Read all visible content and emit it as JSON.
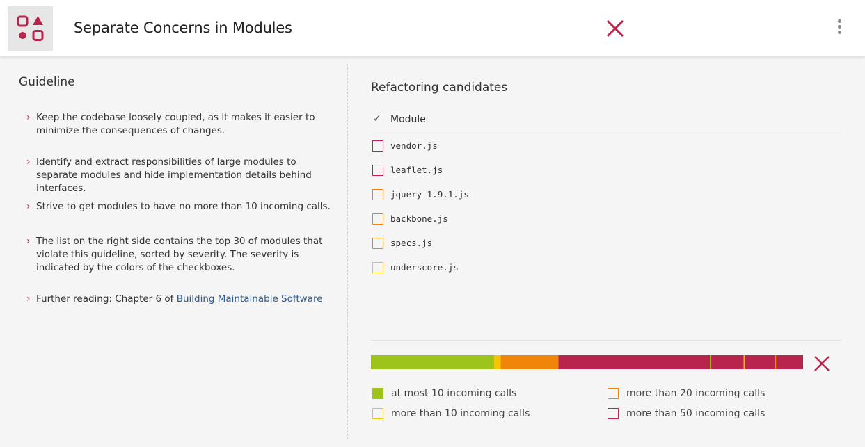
{
  "header": {
    "title": "Separate Concerns in Modules",
    "logo_icon": "modules-grid-icon",
    "status_icon": "fail-x-icon",
    "menu_icon": "kebab-menu-icon"
  },
  "guideline": {
    "heading": "Guideline",
    "items": [
      "Keep the codebase loosely coupled, as it makes it easier to minimize the consequences of changes.",
      "Identify and extract responsibilities of large modules to separate modules and hide implementation details behind interfaces.",
      "Strive to get modules to have no more than 10 incoming calls.",
      "The list on the right side contains the top 30 of modules that violate this guideline, sorted by severity. The severity is indicated by the colors of the checkboxes."
    ],
    "further_prefix": "Further reading: Chapter 6 of ",
    "further_link": "Building Maintainable Software"
  },
  "candidates": {
    "heading": "Refactoring candidates",
    "column_label": "Module",
    "modules": [
      {
        "name": "vendor.js",
        "color": "#b8244c"
      },
      {
        "name": "leaflet.js",
        "color": "#b8244c"
      },
      {
        "name": "jquery-1.9.1.js",
        "color": "#f0850a"
      },
      {
        "name": "backbone.js",
        "color": "#f0850a"
      },
      {
        "name": "specs.js",
        "color": "#f0850a"
      },
      {
        "name": "underscore.js",
        "color": "#f5c400"
      }
    ]
  },
  "distribution": {
    "segments": [
      {
        "label": "at most 10 incoming calls",
        "fraction": 0.285,
        "color": "#9dc41a"
      },
      {
        "label": "more than 10 incoming calls",
        "fraction": 0.015,
        "color": "#f5c400"
      },
      {
        "label": "more than 20 incoming calls",
        "fraction": 0.134,
        "color": "#f0850a"
      },
      {
        "label": "more than 50 incoming calls",
        "fraction": 0.566,
        "color": "#b8244c"
      }
    ],
    "markers": [
      {
        "fraction": 0.786,
        "color": "#9dc41a"
      },
      {
        "fraction": 0.864,
        "color": "#f5c400"
      },
      {
        "fraction": 0.936,
        "color": "#f0850a"
      }
    ],
    "status_icon": "fail-x-icon",
    "legend": [
      {
        "label": "at most 10 incoming calls",
        "color": "#9dc41a",
        "filled": true
      },
      {
        "label": "more than 10 incoming calls",
        "color": "#f5c400",
        "filled": false
      },
      {
        "label": "more than 20 incoming calls",
        "color": "#f0850a",
        "filled": false
      },
      {
        "label": "more than 50 incoming calls",
        "color": "#b8244c",
        "filled": false
      }
    ]
  },
  "colors": {
    "accent": "#b8244c",
    "link": "#2b5a8e"
  }
}
